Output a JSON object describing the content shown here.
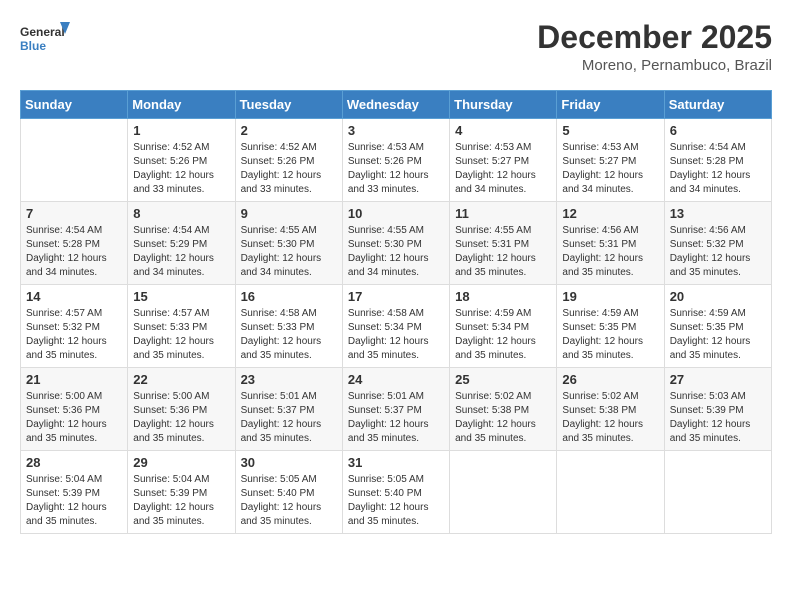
{
  "header": {
    "logo_line1": "General",
    "logo_line2": "Blue",
    "main_title": "December 2025",
    "subtitle": "Moreno, Pernambuco, Brazil"
  },
  "weekdays": [
    "Sunday",
    "Monday",
    "Tuesday",
    "Wednesday",
    "Thursday",
    "Friday",
    "Saturday"
  ],
  "weeks": [
    [
      {
        "day": "",
        "info": ""
      },
      {
        "day": "1",
        "info": "Sunrise: 4:52 AM\nSunset: 5:26 PM\nDaylight: 12 hours\nand 33 minutes."
      },
      {
        "day": "2",
        "info": "Sunrise: 4:52 AM\nSunset: 5:26 PM\nDaylight: 12 hours\nand 33 minutes."
      },
      {
        "day": "3",
        "info": "Sunrise: 4:53 AM\nSunset: 5:26 PM\nDaylight: 12 hours\nand 33 minutes."
      },
      {
        "day": "4",
        "info": "Sunrise: 4:53 AM\nSunset: 5:27 PM\nDaylight: 12 hours\nand 34 minutes."
      },
      {
        "day": "5",
        "info": "Sunrise: 4:53 AM\nSunset: 5:27 PM\nDaylight: 12 hours\nand 34 minutes."
      },
      {
        "day": "6",
        "info": "Sunrise: 4:54 AM\nSunset: 5:28 PM\nDaylight: 12 hours\nand 34 minutes."
      }
    ],
    [
      {
        "day": "7",
        "info": "Sunrise: 4:54 AM\nSunset: 5:28 PM\nDaylight: 12 hours\nand 34 minutes."
      },
      {
        "day": "8",
        "info": "Sunrise: 4:54 AM\nSunset: 5:29 PM\nDaylight: 12 hours\nand 34 minutes."
      },
      {
        "day": "9",
        "info": "Sunrise: 4:55 AM\nSunset: 5:30 PM\nDaylight: 12 hours\nand 34 minutes."
      },
      {
        "day": "10",
        "info": "Sunrise: 4:55 AM\nSunset: 5:30 PM\nDaylight: 12 hours\nand 34 minutes."
      },
      {
        "day": "11",
        "info": "Sunrise: 4:55 AM\nSunset: 5:31 PM\nDaylight: 12 hours\nand 35 minutes."
      },
      {
        "day": "12",
        "info": "Sunrise: 4:56 AM\nSunset: 5:31 PM\nDaylight: 12 hours\nand 35 minutes."
      },
      {
        "day": "13",
        "info": "Sunrise: 4:56 AM\nSunset: 5:32 PM\nDaylight: 12 hours\nand 35 minutes."
      }
    ],
    [
      {
        "day": "14",
        "info": "Sunrise: 4:57 AM\nSunset: 5:32 PM\nDaylight: 12 hours\nand 35 minutes."
      },
      {
        "day": "15",
        "info": "Sunrise: 4:57 AM\nSunset: 5:33 PM\nDaylight: 12 hours\nand 35 minutes."
      },
      {
        "day": "16",
        "info": "Sunrise: 4:58 AM\nSunset: 5:33 PM\nDaylight: 12 hours\nand 35 minutes."
      },
      {
        "day": "17",
        "info": "Sunrise: 4:58 AM\nSunset: 5:34 PM\nDaylight: 12 hours\nand 35 minutes."
      },
      {
        "day": "18",
        "info": "Sunrise: 4:59 AM\nSunset: 5:34 PM\nDaylight: 12 hours\nand 35 minutes."
      },
      {
        "day": "19",
        "info": "Sunrise: 4:59 AM\nSunset: 5:35 PM\nDaylight: 12 hours\nand 35 minutes."
      },
      {
        "day": "20",
        "info": "Sunrise: 4:59 AM\nSunset: 5:35 PM\nDaylight: 12 hours\nand 35 minutes."
      }
    ],
    [
      {
        "day": "21",
        "info": "Sunrise: 5:00 AM\nSunset: 5:36 PM\nDaylight: 12 hours\nand 35 minutes."
      },
      {
        "day": "22",
        "info": "Sunrise: 5:00 AM\nSunset: 5:36 PM\nDaylight: 12 hours\nand 35 minutes."
      },
      {
        "day": "23",
        "info": "Sunrise: 5:01 AM\nSunset: 5:37 PM\nDaylight: 12 hours\nand 35 minutes."
      },
      {
        "day": "24",
        "info": "Sunrise: 5:01 AM\nSunset: 5:37 PM\nDaylight: 12 hours\nand 35 minutes."
      },
      {
        "day": "25",
        "info": "Sunrise: 5:02 AM\nSunset: 5:38 PM\nDaylight: 12 hours\nand 35 minutes."
      },
      {
        "day": "26",
        "info": "Sunrise: 5:02 AM\nSunset: 5:38 PM\nDaylight: 12 hours\nand 35 minutes."
      },
      {
        "day": "27",
        "info": "Sunrise: 5:03 AM\nSunset: 5:39 PM\nDaylight: 12 hours\nand 35 minutes."
      }
    ],
    [
      {
        "day": "28",
        "info": "Sunrise: 5:04 AM\nSunset: 5:39 PM\nDaylight: 12 hours\nand 35 minutes."
      },
      {
        "day": "29",
        "info": "Sunrise: 5:04 AM\nSunset: 5:39 PM\nDaylight: 12 hours\nand 35 minutes."
      },
      {
        "day": "30",
        "info": "Sunrise: 5:05 AM\nSunset: 5:40 PM\nDaylight: 12 hours\nand 35 minutes."
      },
      {
        "day": "31",
        "info": "Sunrise: 5:05 AM\nSunset: 5:40 PM\nDaylight: 12 hours\nand 35 minutes."
      },
      {
        "day": "",
        "info": ""
      },
      {
        "day": "",
        "info": ""
      },
      {
        "day": "",
        "info": ""
      }
    ]
  ]
}
